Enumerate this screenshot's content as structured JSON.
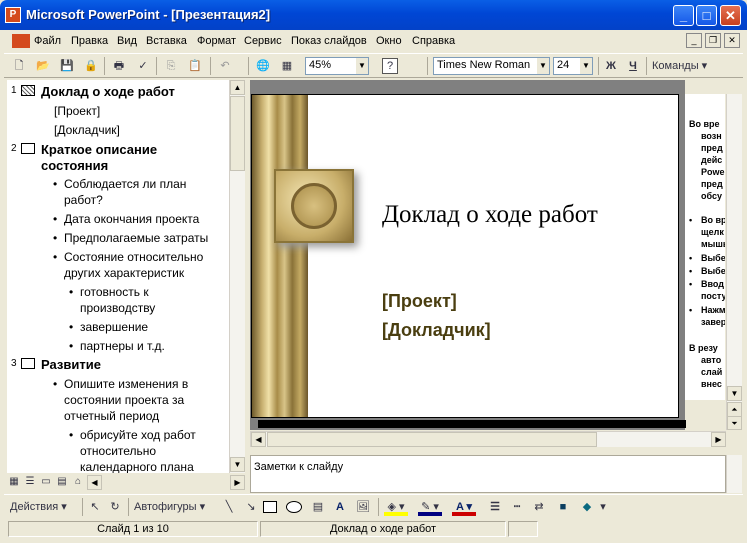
{
  "window": {
    "title": "Microsoft PowerPoint - [Презентация2]"
  },
  "menu": [
    "Файл",
    "Правка",
    "Вид",
    "Вставка",
    "Формат",
    "Сервис",
    "Показ слайдов",
    "Окно",
    "Справка"
  ],
  "toolbar": {
    "zoom": "45%",
    "font": "Times New Roman",
    "size": "24",
    "bold": "Ж",
    "underline": "Ч",
    "commands": "Команды"
  },
  "outline": {
    "slide1": {
      "num": "1",
      "title": "Доклад о ходе работ",
      "sub1": "[Проект]",
      "sub2": "[Докладчик]"
    },
    "slide2": {
      "num": "2",
      "title1": "Краткое описание",
      "title2": "состояния",
      "b1a": "Соблюдается ли план",
      "b1b": "работ?",
      "b2": "Дата окончания проекта",
      "b3": "Предполагаемые затраты",
      "b4a": "Состояние относительно",
      "b4b": "других характеристик",
      "s1a": "готовность к",
      "s1b": "производству",
      "s2": "завершение",
      "s3": "партнеры и т.д."
    },
    "slide3": {
      "num": "3",
      "title": "Развитие",
      "b1a": "Опишите изменения в",
      "b1b": "состоянии проекта за",
      "b1c": "отчетный период",
      "s1a": "обрисуйте ход работ",
      "s1b": "относительно",
      "s1c": "календарного плана"
    }
  },
  "slide": {
    "title": "Доклад о ходе работ",
    "project": "[Проект]",
    "speaker": "[Докладчик]"
  },
  "taskpane": {
    "lines": [
      "Во вре",
      "возн",
      "пред",
      "дейс",
      "Powe",
      "пред",
      "обсу"
    ],
    "bullets": [
      "Во вр",
      "щелк",
      "мышь",
      "Выбе",
      "Выбе",
      "Ввод",
      "посту",
      "Нажм",
      "завер"
    ],
    "tail": [
      "В резу",
      "авто",
      "слай",
      "внес"
    ]
  },
  "notes": {
    "placeholder": "Заметки к слайду"
  },
  "drawing": {
    "actions": "Действия",
    "autoshapes": "Автофигуры"
  },
  "status": {
    "slide": "Слайд 1 из 10",
    "design": "Доклад о ходе работ"
  }
}
